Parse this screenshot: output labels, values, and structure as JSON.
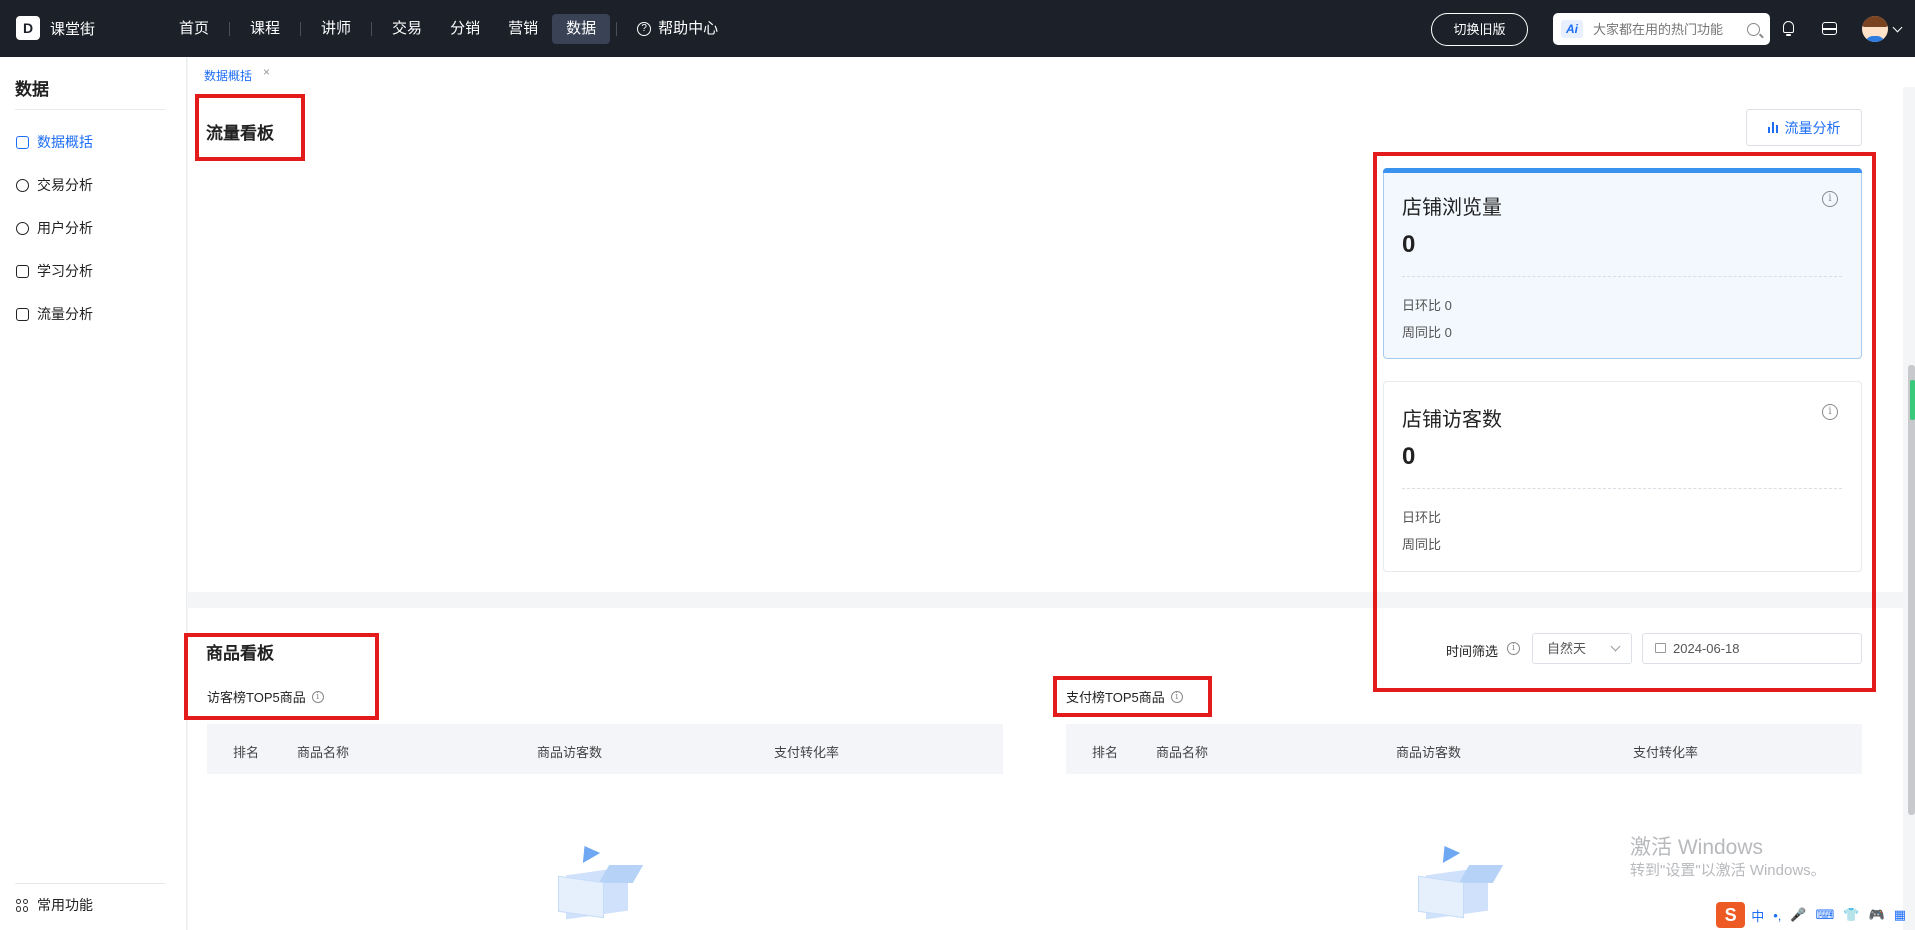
{
  "topbar": {
    "brand_name": "课堂街",
    "brand_logo": "D",
    "nav": [
      "首页",
      "课程",
      "讲师",
      "交易",
      "分销",
      "营销",
      "数据",
      "帮助中心"
    ],
    "active_nav": "数据",
    "switch_label": "切换旧版",
    "ai_badge": "Ai",
    "search_placeholder": "大家都在用的热门功能"
  },
  "sidebar": {
    "title": "数据",
    "items": [
      "数据概括",
      "交易分析",
      "用户分析",
      "学习分析",
      "流量分析"
    ],
    "bottom": "常用功能"
  },
  "breadcrumb": {
    "current": "数据概括",
    "close": "×"
  },
  "traffic": {
    "title": "流量看板",
    "analysis_button": "流量分析",
    "cards": [
      {
        "title": "店铺浏览量",
        "value": "0",
        "day_ratio": "日环比 0",
        "week_ratio": "周同比 0"
      },
      {
        "title": "店铺访客数",
        "value": "0",
        "day_ratio": "日环比",
        "week_ratio": "周同比"
      }
    ]
  },
  "filter": {
    "label": "时间筛选",
    "select_value": "自然天",
    "date_value": "2024-06-18"
  },
  "goods": {
    "title": "商品看板",
    "left_table": {
      "title": "访客榜TOP5商品",
      "columns": [
        "排名",
        "商品名称",
        "商品访客数",
        "支付转化率"
      ]
    },
    "right_table": {
      "title": "支付榜TOP5商品",
      "columns": [
        "排名",
        "商品名称",
        "商品访客数",
        "支付转化率"
      ]
    }
  },
  "watermark": {
    "line1": "激活 Windows",
    "line2": "转到\"设置\"以激活 Windows。"
  },
  "ime": {
    "s_logo": "S",
    "items": [
      "中",
      "•,",
      "🎤",
      "⌨",
      "👕",
      "🎮",
      "▦"
    ]
  },
  "colors": {
    "accent": "#1e6ef5",
    "topbar": "#1b2029",
    "highlight_border": "#e41b1b",
    "card_topbar": "#3b93f0"
  }
}
